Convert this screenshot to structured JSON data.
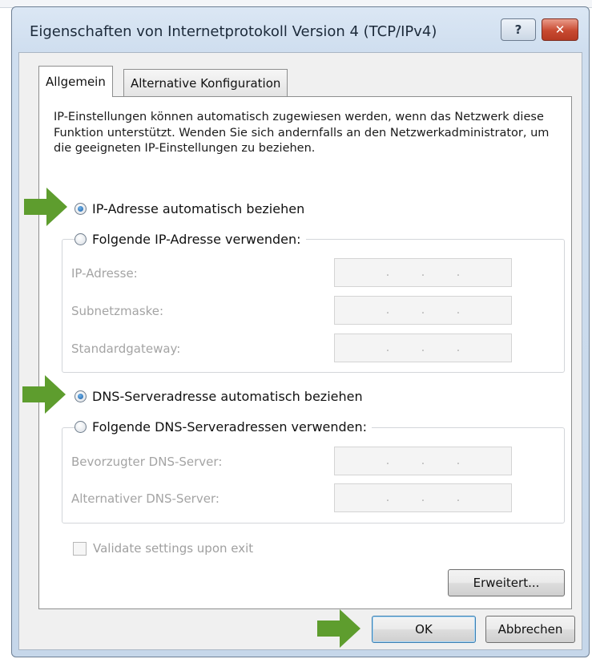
{
  "window": {
    "title": "Eigenschaften von Internetprotokoll Version 4 (TCP/IPv4)",
    "help_glyph": "?",
    "close_glyph": "✕"
  },
  "tabs": [
    {
      "label": "Allgemein",
      "active": true
    },
    {
      "label": "Alternative Konfiguration",
      "active": false
    }
  ],
  "description": "IP-Einstellungen können automatisch zugewiesen werden, wenn das Netzwerk diese Funktion unterstützt. Wenden Sie sich andernfalls an den Netzwerkadministrator, um die geeigneten IP-Einstellungen zu beziehen.",
  "ip_section": {
    "auto_label": "IP-Adresse automatisch beziehen",
    "auto_checked": true,
    "manual_label": "Folgende IP-Adresse verwenden:",
    "manual_checked": false,
    "fields": [
      {
        "label": "IP-Adresse:",
        "value": ""
      },
      {
        "label": "Subnetzmaske:",
        "value": ""
      },
      {
        "label": "Standardgateway:",
        "value": ""
      }
    ]
  },
  "dns_section": {
    "auto_label": "DNS-Serveradresse automatisch beziehen",
    "auto_checked": true,
    "manual_label": "Folgende DNS-Serveradressen verwenden:",
    "manual_checked": false,
    "fields": [
      {
        "label": "Bevorzugter DNS-Server:",
        "value": ""
      },
      {
        "label": "Alternativer DNS-Server:",
        "value": ""
      }
    ]
  },
  "ip_separator": ".",
  "validate": {
    "label": "Validate settings upon exit",
    "checked": false
  },
  "buttons": {
    "advanced": "Erweitert...",
    "ok": "OK",
    "cancel": "Abbrechen"
  },
  "colors": {
    "arrow": "#5e9d2e",
    "title_bar": "#cfdeef",
    "close_button": "#c84a31"
  },
  "icons": [
    "question-icon",
    "close-icon",
    "arrow-right-icon"
  ]
}
